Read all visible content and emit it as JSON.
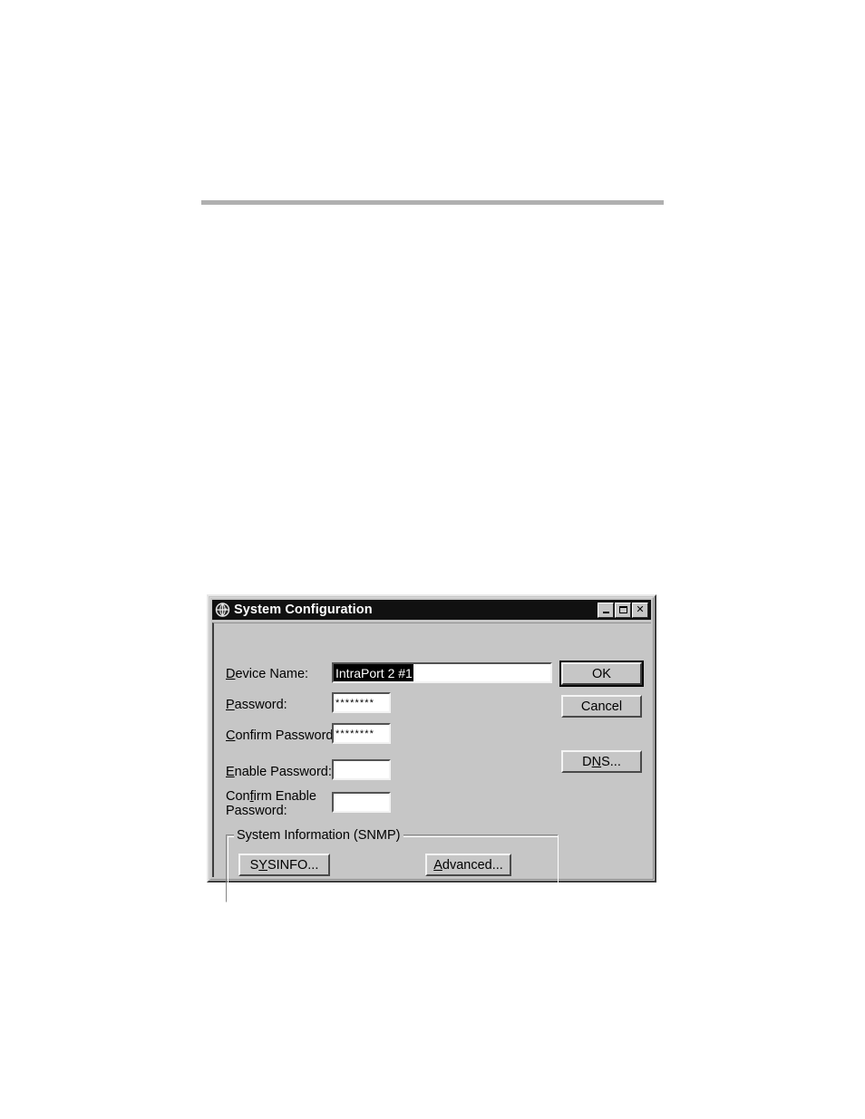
{
  "page": {
    "rule_present": true,
    "background_color": "#ffffff"
  },
  "dialog": {
    "title": "System Configuration",
    "title_icon": "globe-network-icon",
    "titlebar_color": "#111111",
    "face_color": "#c6c6c6",
    "window_buttons": [
      {
        "name": "minimize",
        "label": "_"
      },
      {
        "name": "maximize",
        "label": "□"
      },
      {
        "name": "close",
        "label": "✕"
      }
    ],
    "fields": [
      {
        "label_pre": "",
        "label_mnemonic": "D",
        "label_post": "evice Name:",
        "value": "IntraPort 2 #1",
        "selected": true,
        "masked": false,
        "placeholder": ""
      },
      {
        "label_pre": "",
        "label_mnemonic": "P",
        "label_post": "assword:",
        "value": "********",
        "selected": false,
        "masked": true,
        "placeholder": ""
      },
      {
        "label_pre": "",
        "label_mnemonic": "C",
        "label_post": "onfirm Password:",
        "value": "********",
        "selected": false,
        "masked": true,
        "placeholder": ""
      },
      {
        "label_pre": "",
        "label_mnemonic": "E",
        "label_post": "nable Password:",
        "value": "",
        "selected": false,
        "masked": true,
        "placeholder": ""
      },
      {
        "label_pre": "Con",
        "label_mnemonic": "f",
        "label_post": "irm Enable",
        "label_line2": "Password:",
        "value": "",
        "selected": false,
        "masked": true,
        "placeholder": ""
      }
    ],
    "buttons": {
      "ok": {
        "label": "OK",
        "default": true
      },
      "cancel": {
        "label": "Cancel",
        "default": false
      },
      "dns": {
        "pre": "D",
        "mnemonic": "N",
        "post": "S...",
        "label": "DNS..."
      }
    },
    "group": {
      "title": "System Information (SNMP)",
      "sysinfo": {
        "pre": "S",
        "mnemonic": "Y",
        "post": "SINFO...",
        "label": "SYSINFO..."
      },
      "advanced": {
        "pre": "",
        "mnemonic": "A",
        "post": "dvanced...",
        "label": "Advanced..."
      }
    }
  }
}
